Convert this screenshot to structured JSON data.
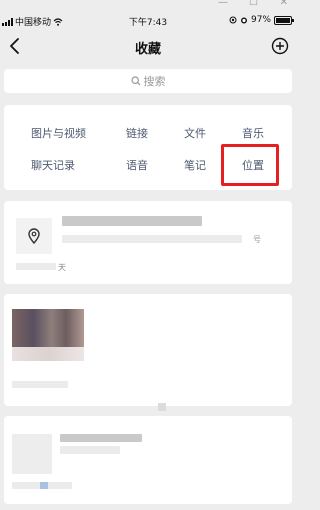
{
  "window_controls": {
    "minimize": "—",
    "maximize": "☐",
    "close": "✕"
  },
  "status_bar": {
    "carrier": "中国移动",
    "time": "下午7:43",
    "battery": "97%"
  },
  "nav": {
    "title": "收藏"
  },
  "search": {
    "label": "搜索"
  },
  "categories": [
    {
      "label": "图片与视频"
    },
    {
      "label": "链接"
    },
    {
      "label": "文件"
    },
    {
      "label": "音乐"
    },
    {
      "label": "聊天记录"
    },
    {
      "label": "语音"
    },
    {
      "label": "笔记"
    },
    {
      "label": "位置"
    }
  ],
  "items": [
    {
      "type": "location",
      "address_suffix": "号",
      "time_suffix": "天"
    },
    {
      "type": "image"
    },
    {
      "type": "file"
    }
  ],
  "colors": {
    "background": "#ededed",
    "card": "#ffffff",
    "category_text": "#4c5a70",
    "highlight": "#e62020"
  }
}
